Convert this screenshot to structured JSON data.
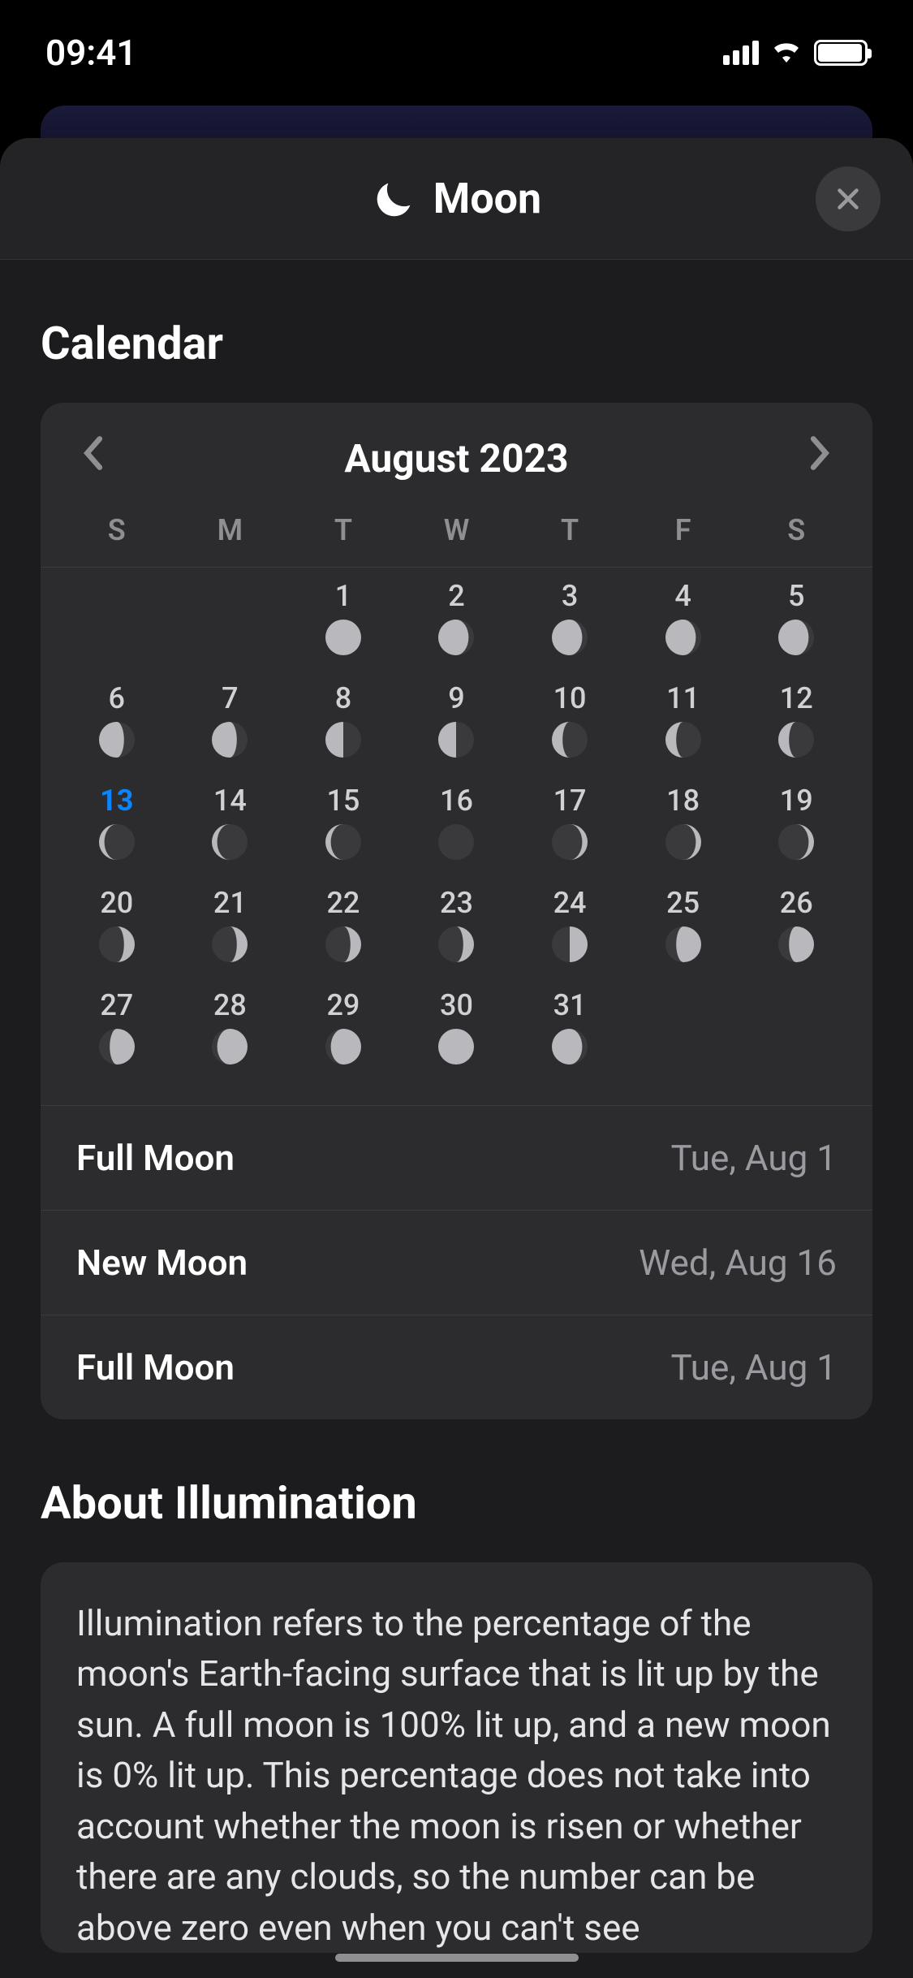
{
  "status": {
    "time": "09:41"
  },
  "sheet": {
    "title": "Moon"
  },
  "calendar": {
    "section_title": "Calendar",
    "month_label": "August 2023",
    "weekdays": [
      "S",
      "M",
      "T",
      "W",
      "T",
      "F",
      "S"
    ],
    "today": 13,
    "days": [
      {
        "n": null
      },
      {
        "n": null
      },
      {
        "n": 1,
        "p": "full"
      },
      {
        "n": 2,
        "p": "wg3"
      },
      {
        "n": 3,
        "p": "wg3"
      },
      {
        "n": 4,
        "p": "wg3"
      },
      {
        "n": 5,
        "p": "wg3"
      },
      {
        "n": 6,
        "p": "wg2"
      },
      {
        "n": 7,
        "p": "wg2"
      },
      {
        "n": 8,
        "p": "lq"
      },
      {
        "n": 9,
        "p": "lq"
      },
      {
        "n": 10,
        "p": "wc2"
      },
      {
        "n": 11,
        "p": "wc2"
      },
      {
        "n": 12,
        "p": "wc2"
      },
      {
        "n": 13,
        "p": "wc1"
      },
      {
        "n": 14,
        "p": "wc1"
      },
      {
        "n": 15,
        "p": "wc1"
      },
      {
        "n": 16,
        "p": "new"
      },
      {
        "n": 17,
        "p": "xc1"
      },
      {
        "n": 18,
        "p": "xc1"
      },
      {
        "n": 19,
        "p": "xc1"
      },
      {
        "n": 20,
        "p": "xc2"
      },
      {
        "n": 21,
        "p": "xc2"
      },
      {
        "n": 22,
        "p": "xc2"
      },
      {
        "n": 23,
        "p": "xc2"
      },
      {
        "n": 24,
        "p": "fq"
      },
      {
        "n": 25,
        "p": "xg2"
      },
      {
        "n": 26,
        "p": "xg2"
      },
      {
        "n": 27,
        "p": "xg2"
      },
      {
        "n": 28,
        "p": "xg3"
      },
      {
        "n": 29,
        "p": "xg3"
      },
      {
        "n": 30,
        "p": "full"
      },
      {
        "n": 31,
        "p": "wg3"
      }
    ],
    "events": [
      {
        "label": "Full Moon",
        "date": "Tue, Aug 1"
      },
      {
        "label": "New Moon",
        "date": "Wed, Aug 16"
      },
      {
        "label": "Full Moon",
        "date": "Tue, Aug 1"
      }
    ]
  },
  "about": {
    "section_title": "About Illumination",
    "body": "Illumination refers to the percentage of the moon's Earth-facing surface that is lit up by the sun. A full moon is 100% lit up, and a new moon is 0% lit up. This percentage does not take into account whether the moon is risen or whether there are any clouds, so the number can be above zero even when you can't see"
  }
}
